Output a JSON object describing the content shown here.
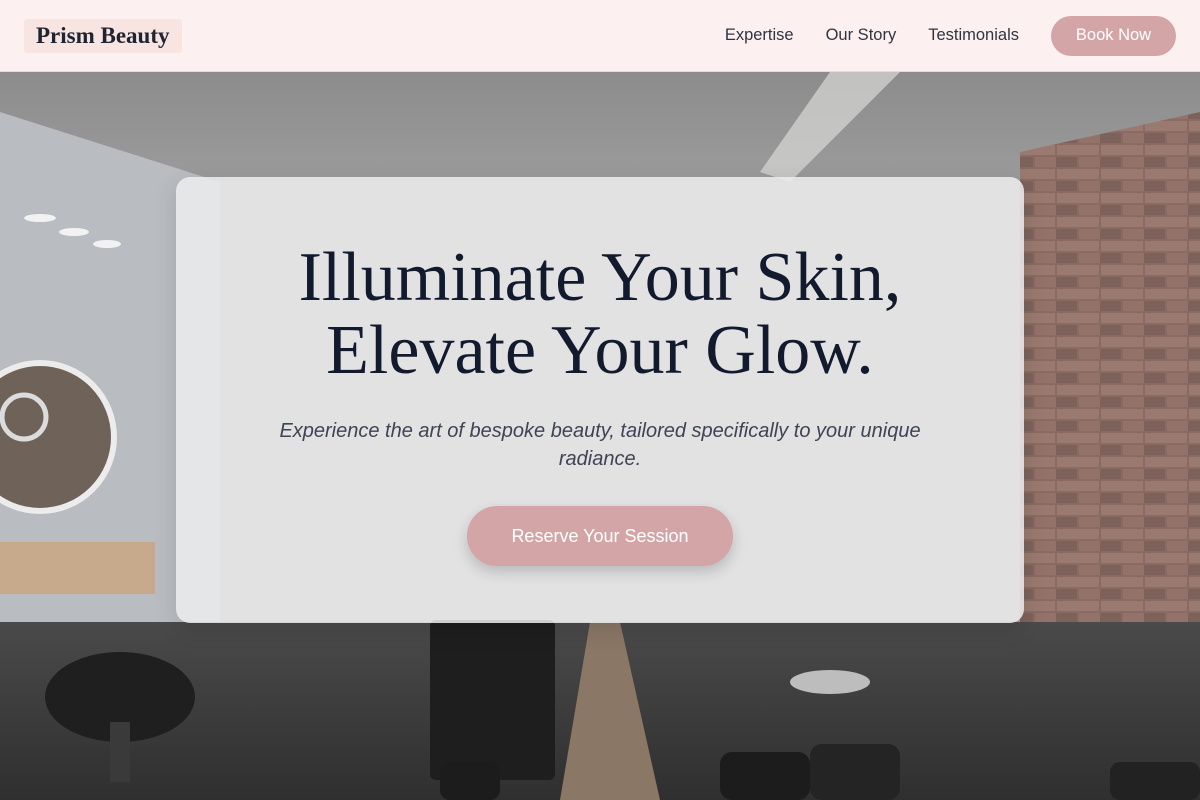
{
  "header": {
    "logo": "Prism Beauty",
    "nav": [
      {
        "label": "Expertise"
      },
      {
        "label": "Our Story"
      },
      {
        "label": "Testimonials"
      }
    ],
    "cta_label": "Book Now"
  },
  "hero": {
    "title_line1": "Illuminate Your Skin,",
    "title_line2": "Elevate Your Glow.",
    "subtitle": "Experience the art of bespoke beauty, tailored specifically to your unique radiance.",
    "cta_label": "Reserve Your Session"
  },
  "colors": {
    "header_bg": "#fcf1f0",
    "accent": "#d4a5a7",
    "title": "#121a2e",
    "subtitle": "#3d4454"
  }
}
